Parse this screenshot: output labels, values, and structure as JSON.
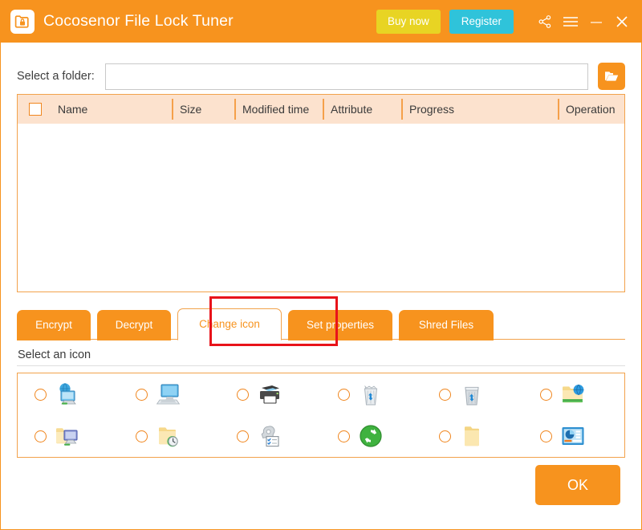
{
  "window": {
    "title": "Cocosenor File Lock Tuner",
    "app_icon": "folder-lock-icon",
    "accent_color": "#F7931E",
    "buy_color": "#E8D423",
    "register_color": "#2FC3DA",
    "annotation_color": "#E8131A"
  },
  "titlebar": {
    "buy_label": "Buy now",
    "register_label": "Register",
    "share_icon": "share-icon",
    "menu_icon": "hamburger-menu-icon",
    "minimize_icon": "minimize-icon",
    "close_icon": "close-icon"
  },
  "folder": {
    "label": "Select a folder:",
    "value": "",
    "placeholder": "",
    "browse_icon": "open-folder-icon"
  },
  "filelist": {
    "select_all_checked": false,
    "columns": [
      "Name",
      "Size",
      "Modified time",
      "Attribute",
      "Progress",
      "Operation"
    ],
    "rows": []
  },
  "tabs": [
    {
      "label": "Encrypt",
      "active": false
    },
    {
      "label": "Decrypt",
      "active": false
    },
    {
      "label": "Change icon",
      "active": true
    },
    {
      "label": "Set properties",
      "active": false
    },
    {
      "label": "Shred Files",
      "active": false
    }
  ],
  "icon_section": {
    "label": "Select an icon",
    "selected_index": -1,
    "icons": [
      {
        "name": "network-computers-icon"
      },
      {
        "name": "computer-monitor-icon"
      },
      {
        "name": "printer-icon"
      },
      {
        "name": "recycle-bin-full-icon"
      },
      {
        "name": "recycle-bin-empty-icon"
      },
      {
        "name": "web-folder-icon"
      },
      {
        "name": "network-folder-icon"
      },
      {
        "name": "recent-folder-clock-icon"
      },
      {
        "name": "scheduled-tasks-icon"
      },
      {
        "name": "sync-refresh-icon"
      },
      {
        "name": "plain-folder-icon"
      },
      {
        "name": "presentation-chart-icon"
      }
    ]
  },
  "footer": {
    "ok_label": "OK"
  }
}
